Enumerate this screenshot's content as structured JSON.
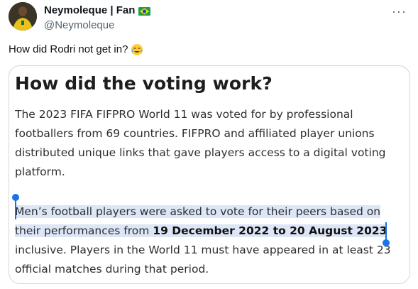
{
  "author": {
    "display_name": "Neymoleque | Fan",
    "handle": "@Neymoleque"
  },
  "tweet": {
    "text": "How did Rodri not get in?"
  },
  "icons": {
    "flag": "brazil-flag-icon",
    "emoji": "tears-of-joy-emoji-icon",
    "more": "more-options-icon"
  },
  "card": {
    "title": "How did the voting work?",
    "paragraph1": [
      "The 2023 FIFA FIFPRO World 11 was voted for by professional",
      "footballers from 69 countries. FIFPRO and affiliated player unions",
      "distributed unique links that gave players access to a digital voting",
      "platform."
    ],
    "paragraph2": {
      "line1": "Men’s football players were asked to vote for their peers based on",
      "line2_prefix": "their performances from ",
      "line2_bold": "19 December 2022 to 20 August 2023",
      "line3": "inclusive. Players in the World 11 must have appeared in at least 23",
      "line4": "official matches during that period."
    }
  },
  "colors": {
    "selection": "#dce6f6",
    "selection_handle": "#1a73e8",
    "secondary_text": "#536471"
  }
}
